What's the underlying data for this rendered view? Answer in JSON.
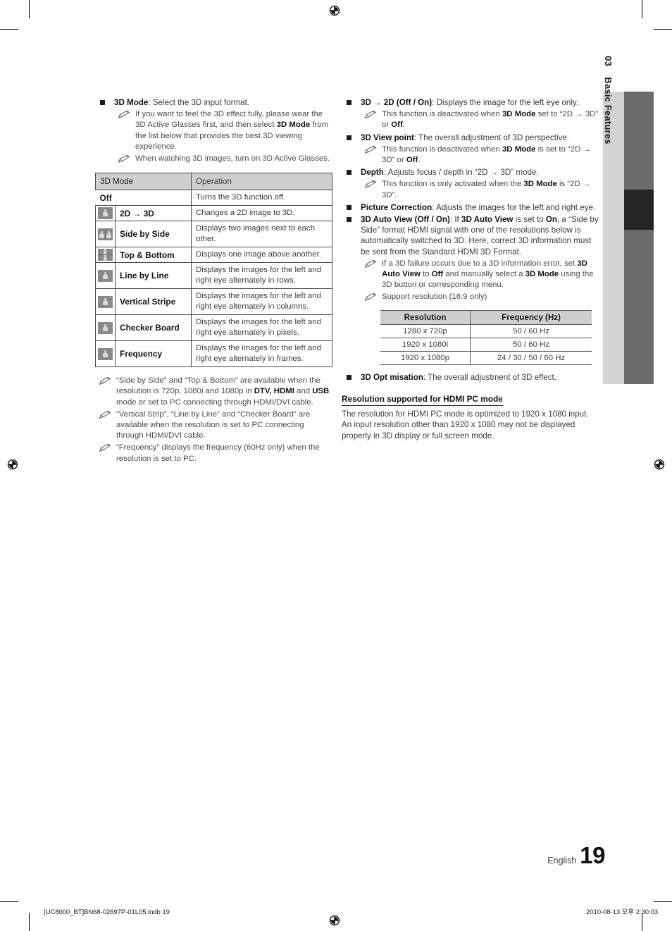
{
  "page": {
    "language": "English",
    "number": "19",
    "chapter_number": "03",
    "chapter_title": "Basic Features",
    "print_footer": "[UC8000_BT]BN68-02697P-01L05.indb   19",
    "print_date": "2010-08-13   오후 2:30:03"
  },
  "left_column": {
    "main_bullet": {
      "label": "3D Mode",
      "text": ": Select the 3D input format."
    },
    "notes": [
      "If you want to feel the 3D effect fully, please wear the 3D Active Glasses first, and then select <b>3D Mode</b> from the list below that provides the best 3D viewing experience.",
      "When watching 3D images, turn on 3D Active Glasses."
    ],
    "mode_table": {
      "headers": [
        "3D Mode",
        "Operation"
      ],
      "rows": [
        {
          "icon": "none",
          "name": "Off",
          "operation": "Turns the 3D function off."
        },
        {
          "icon": "two-d-to-3d",
          "name": "2D → 3D",
          "operation": "Changes a 2D image to 3D."
        },
        {
          "icon": "side-by-side",
          "name": "Side by Side",
          "operation": "Displays two images next to each other."
        },
        {
          "icon": "top-and-bottom",
          "name": "Top & Bottom",
          "operation": "Displays one image above another."
        },
        {
          "icon": "line-by-line",
          "name": "Line by Line",
          "operation": "Displays the images for the left and right eye alternately in rows."
        },
        {
          "icon": "vertical-stripe",
          "name": "Vertical Stripe",
          "operation": "Displays the images for the left and right eye alternately in columns."
        },
        {
          "icon": "checker-board",
          "name": "Checker Board",
          "operation": "Displays the images for the left and right eye alternately in pixels."
        },
        {
          "icon": "frequency",
          "name": "Frequency",
          "operation": "Displays the images for the left and right eye alternately in frames."
        }
      ]
    },
    "footer_notes": [
      "“Side by Side” and “Top & Bottom” are available when the resolution is 720p, 1080i and 1080p in <b>DTV, HDMI</b> and <b>USB</b> mode or set to PC connecting through HDMI/DVI cable.",
      "“Vertical Strip”, “Line by Line” and “Checker Board” are available when the resolution is set to PC connecting through HDMI/DVI cable.",
      "“Frequency” displays the frequency (60Hz only) when the resolution is set to PC."
    ]
  },
  "right_column": {
    "bullets": [
      {
        "html": "<b>3D → 2D (Off / On)</b>: Displays the image for the left eye only.",
        "notes": [
          "This function is deactivated when <b>3D Mode</b> set to “2D → 3D” or <b>Off</b>."
        ]
      },
      {
        "html": "<b>3D View point</b>: The overall adjustment of 3D perspective.",
        "notes": [
          "This function is deactivated when <b>3D Mode</b> is set to “2D → 3D” or <b>Off</b>."
        ]
      },
      {
        "html": "<b>Depth</b>: Adjusts focus / depth in “2D → 3D” mode.",
        "notes": [
          "This function is only activated when the <b>3D Mode</b> is “2D → 3D”."
        ]
      },
      {
        "html": "<b>Picture Correction</b>: Adjusts the images for the left and right eye.",
        "notes": []
      },
      {
        "html": "<b>3D Auto View (Off / On)</b>: If <b>3D Auto View</b> is set to <b>On</b>, a “Side by Side” format HDMI signal with one of the resolutions below is automatically switched to 3D. Here, correct 3D information must be sent from the Standard HDMI 3D Format.",
        "notes": [
          "If a 3D failure occurs due to a 3D information error, set <b>3D Auto View</b> to <b>Off</b> and manually select a <b>3D Mode</b> using the 3D button or corresponding menu.",
          "Support resolution (16:9 only)"
        ]
      }
    ],
    "resolution_table": {
      "headers": [
        "Resolution",
        "Frequency (Hz)"
      ],
      "rows": [
        [
          "1280 x 720p",
          "50 / 60 Hz"
        ],
        [
          "1920 x 1080i",
          "50 / 60 Hz"
        ],
        [
          "1920 x 1080p",
          "24 / 30 / 50 / 60 Hz"
        ]
      ]
    },
    "last_bullet": {
      "html": "<b>3D Opt misation</b>: The overall adjustment of 3D effect."
    },
    "subsection": {
      "heading": "Resolution supported for HDMI PC mode",
      "paragraphs": [
        "The resolution for HDMI PC mode is optimized to 1920 x 1080 input.",
        "An input resolution other than 1920 x 1080 may not be displayed properly in 3D display or full screen mode."
      ]
    }
  }
}
